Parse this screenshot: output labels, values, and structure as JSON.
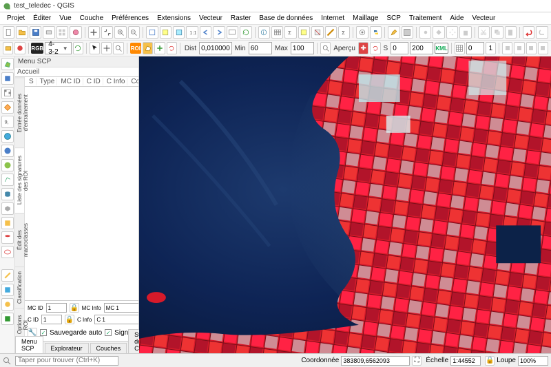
{
  "window": {
    "title": "test_teledec - QGIS"
  },
  "menubar": [
    "Projet",
    "Éditer",
    "Vue",
    "Couche",
    "Préférences",
    "Extensions",
    "Vecteur",
    "Raster",
    "Base de données",
    "Internet",
    "Maillage",
    "SCP",
    "Traitement",
    "Aide",
    "Vecteur"
  ],
  "toolbar2": {
    "rgb_label": "RGB",
    "rgb_value": "4-3-2",
    "roi_label": "ROI",
    "dist_label": "Dist",
    "dist_value": "0,010000",
    "min_label": "Min",
    "min_value": "60",
    "max_label": "Max",
    "max_value": "100",
    "apercu_label": "Aperçu",
    "s_value": "0",
    "t_value": "200",
    "kml_label": "KML"
  },
  "scp": {
    "panel_title": "Menu SCP",
    "top_tab": "Accueil",
    "side_tabs": [
      "Liste des signatures des ROI",
      "Édit des macroclasses",
      "Classification",
      "Options ROI",
      "Entrée données d'entraînement"
    ],
    "columns": [
      "S",
      "Type",
      "MC ID",
      "C ID",
      "C Info",
      "Couleu"
    ],
    "form": {
      "mcid_label": "MC ID",
      "mcid_value": "1",
      "mcinfo_label": "MC Info",
      "mcinfo_value": "MC 1",
      "cid_label": "C ID",
      "cid_value": "1",
      "cinfo_label": "C Info",
      "cinfo_value": "C 1",
      "save_auto": "Sauvegarde auto",
      "signature": "Signature"
    },
    "bottom_tabs": [
      "Menu SCP",
      "Explorateur",
      "Couches",
      "Style de Couche"
    ]
  },
  "statusbar": {
    "search_placeholder": "Taper pour trouver (Ctrl+K)",
    "coord_label": "Coordonnée",
    "coord_value": "383809,6562093",
    "scale_label": "Échelle",
    "scale_value": "1:44552",
    "loupe_label": "Loupe",
    "loupe_value": "100%"
  },
  "chart_data": {
    "type": "map",
    "description": "False-color satellite composite over a coastal bay",
    "bands": "RGB = 4-3-2 (near-infrared, red, green)",
    "land_cover": {
      "vegetation": "red/magenta",
      "bare_or_urban": "cyan/white",
      "water": "deep blue"
    },
    "approx_center_xy": [
      383809,
      6562093
    ],
    "scale_denominator": 44552
  }
}
